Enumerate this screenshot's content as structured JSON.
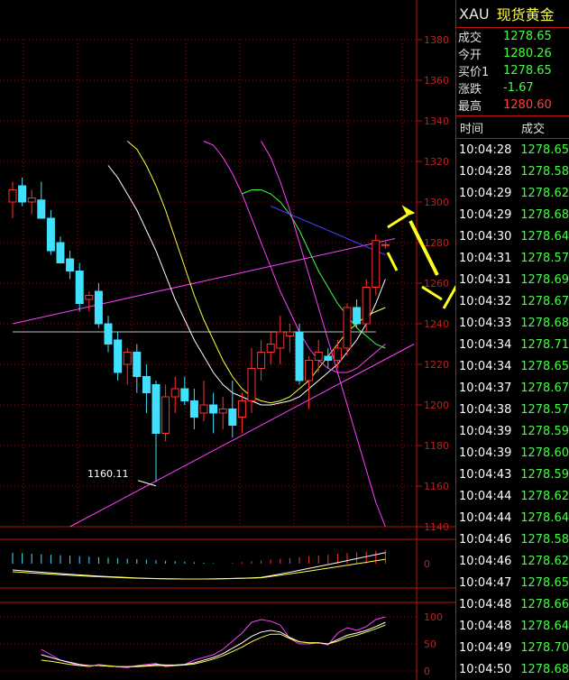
{
  "header": {
    "symbol": "XAU",
    "name": "现货黄金"
  },
  "quotes": [
    {
      "label": "成交",
      "value": "1278.65",
      "color": "green"
    },
    {
      "label": "今开",
      "value": "1280.26",
      "color": "green"
    },
    {
      "label": "买价1",
      "value": "1278.65",
      "color": "green"
    },
    {
      "label": "涨跌",
      "value": "-1.67",
      "color": "green"
    },
    {
      "label": "最高",
      "value": "1280.60",
      "color": "red"
    }
  ],
  "ticks_header": {
    "time": "时间",
    "price": "成交"
  },
  "ticks": [
    {
      "time": "10:04:28",
      "price": "1278.65"
    },
    {
      "time": "10:04:28",
      "price": "1278.58"
    },
    {
      "time": "10:04:29",
      "price": "1278.62"
    },
    {
      "time": "10:04:29",
      "price": "1278.68"
    },
    {
      "time": "10:04:30",
      "price": "1278.64"
    },
    {
      "time": "10:04:31",
      "price": "1278.57"
    },
    {
      "time": "10:04:31",
      "price": "1278.69"
    },
    {
      "time": "10:04:32",
      "price": "1278.67"
    },
    {
      "time": "10:04:33",
      "price": "1278.68"
    },
    {
      "time": "10:04:34",
      "price": "1278.71"
    },
    {
      "time": "10:04:34",
      "price": "1278.65"
    },
    {
      "time": "10:04:37",
      "price": "1278.67"
    },
    {
      "time": "10:04:38",
      "price": "1278.57"
    },
    {
      "time": "10:04:39",
      "price": "1278.59"
    },
    {
      "time": "10:04:39",
      "price": "1278.60"
    },
    {
      "time": "10:04:43",
      "price": "1278.59"
    },
    {
      "time": "10:04:44",
      "price": "1278.62"
    },
    {
      "time": "10:04:44",
      "price": "1278.64"
    },
    {
      "time": "10:04:46",
      "price": "1278.58"
    },
    {
      "time": "10:04:46",
      "price": "1278.62"
    },
    {
      "time": "10:04:47",
      "price": "1278.65"
    },
    {
      "time": "10:04:48",
      "price": "1278.66"
    },
    {
      "time": "10:04:48",
      "price": "1278.64"
    },
    {
      "time": "10:04:49",
      "price": "1278.70"
    },
    {
      "time": "10:04:50",
      "price": "1278.68"
    }
  ],
  "chart_data": {
    "type": "candlestick",
    "price_axis": {
      "labels": [
        "1380",
        "1360",
        "1340",
        "1320",
        "1300",
        "1280",
        "1260",
        "1240",
        "1220",
        "1200",
        "1180",
        "1160",
        "1140"
      ],
      "ylim": [
        1140,
        1380
      ]
    },
    "low_annotation": {
      "text": "1160.11",
      "value": 1160.11
    },
    "macd_axis": {
      "labels": [
        "0"
      ]
    },
    "osc_axis": {
      "labels": [
        "100",
        "50",
        "0"
      ],
      "ylim": [
        0,
        100
      ]
    },
    "candles": [
      {
        "o": 1300,
        "h": 1310,
        "l": 1292,
        "c": 1306
      },
      {
        "o": 1308,
        "h": 1312,
        "l": 1298,
        "c": 1300
      },
      {
        "o": 1300,
        "h": 1306,
        "l": 1294,
        "c": 1302
      },
      {
        "o": 1301,
        "h": 1310,
        "l": 1294,
        "c": 1292
      },
      {
        "o": 1292,
        "h": 1296,
        "l": 1274,
        "c": 1276
      },
      {
        "o": 1280,
        "h": 1283,
        "l": 1270,
        "c": 1270
      },
      {
        "o": 1272,
        "h": 1276,
        "l": 1262,
        "c": 1266
      },
      {
        "o": 1266,
        "h": 1270,
        "l": 1246,
        "c": 1250
      },
      {
        "o": 1252,
        "h": 1256,
        "l": 1246,
        "c": 1254
      },
      {
        "o": 1256,
        "h": 1260,
        "l": 1238,
        "c": 1240
      },
      {
        "o": 1240,
        "h": 1244,
        "l": 1226,
        "c": 1230
      },
      {
        "o": 1232,
        "h": 1236,
        "l": 1212,
        "c": 1216
      },
      {
        "o": 1220,
        "h": 1228,
        "l": 1210,
        "c": 1226
      },
      {
        "o": 1226,
        "h": 1230,
        "l": 1206,
        "c": 1214
      },
      {
        "o": 1214,
        "h": 1220,
        "l": 1196,
        "c": 1206
      },
      {
        "o": 1210,
        "h": 1212,
        "l": 1162,
        "c": 1186
      },
      {
        "o": 1186,
        "h": 1210,
        "l": 1182,
        "c": 1204
      },
      {
        "o": 1204,
        "h": 1214,
        "l": 1196,
        "c": 1208
      },
      {
        "o": 1208,
        "h": 1214,
        "l": 1200,
        "c": 1202
      },
      {
        "o": 1202,
        "h": 1208,
        "l": 1188,
        "c": 1194
      },
      {
        "o": 1196,
        "h": 1212,
        "l": 1192,
        "c": 1200
      },
      {
        "o": 1200,
        "h": 1206,
        "l": 1186,
        "c": 1196
      },
      {
        "o": 1196,
        "h": 1204,
        "l": 1188,
        "c": 1198
      },
      {
        "o": 1198,
        "h": 1212,
        "l": 1184,
        "c": 1190
      },
      {
        "o": 1194,
        "h": 1206,
        "l": 1186,
        "c": 1202
      },
      {
        "o": 1202,
        "h": 1228,
        "l": 1196,
        "c": 1218
      },
      {
        "o": 1218,
        "h": 1232,
        "l": 1212,
        "c": 1226
      },
      {
        "o": 1226,
        "h": 1236,
        "l": 1220,
        "c": 1230
      },
      {
        "o": 1228,
        "h": 1244,
        "l": 1220,
        "c": 1236
      },
      {
        "o": 1234,
        "h": 1240,
        "l": 1226,
        "c": 1236
      },
      {
        "o": 1236,
        "h": 1240,
        "l": 1210,
        "c": 1212
      },
      {
        "o": 1212,
        "h": 1224,
        "l": 1198,
        "c": 1222
      },
      {
        "o": 1222,
        "h": 1232,
        "l": 1216,
        "c": 1226
      },
      {
        "o": 1224,
        "h": 1228,
        "l": 1218,
        "c": 1222
      },
      {
        "o": 1222,
        "h": 1232,
        "l": 1218,
        "c": 1228
      },
      {
        "o": 1228,
        "h": 1250,
        "l": 1224,
        "c": 1248
      },
      {
        "o": 1248,
        "h": 1252,
        "l": 1238,
        "c": 1240
      },
      {
        "o": 1240,
        "h": 1262,
        "l": 1236,
        "c": 1258
      },
      {
        "o": 1258,
        "h": 1284,
        "l": 1254,
        "c": 1281
      },
      {
        "o": 1279,
        "h": 1281,
        "l": 1277,
        "c": 1279
      }
    ],
    "moving_averages": [
      {
        "color": "#ffffff",
        "values": [
          1318,
          1312,
          1304,
          1296,
          1286,
          1276,
          1264,
          1252,
          1242,
          1232,
          1224,
          1216,
          1210,
          1206,
          1204,
          1202,
          1200,
          1200,
          1201,
          1202,
          1204,
          1208,
          1212,
          1216,
          1220,
          1226,
          1232,
          1240,
          1250,
          1262
        ]
      },
      {
        "color": "#ffff40",
        "values": [
          1330,
          1326,
          1318,
          1308,
          1296,
          1282,
          1268,
          1254,
          1242,
          1232,
          1222,
          1214,
          1208,
          1204,
          1202,
          1201,
          1202,
          1204,
          1208,
          1212,
          1218,
          1224,
          1230,
          1236,
          1240,
          1244,
          1246,
          1248
        ]
      },
      {
        "color": "#ff40ff",
        "values": [
          1330,
          1328,
          1322,
          1314,
          1304,
          1292,
          1280,
          1268,
          1256,
          1246,
          1236,
          1228,
          1222,
          1218,
          1216,
          1216,
          1218,
          1222,
          1226,
          1230
        ]
      },
      {
        "color": "#40ff40",
        "values": [
          1304,
          1306,
          1306,
          1304,
          1300,
          1294,
          1286,
          1276,
          1266,
          1258,
          1250,
          1244,
          1238,
          1234,
          1230,
          1228
        ]
      },
      {
        "color": "#4040ff",
        "values": [
          1298,
          1296,
          1294,
          1292,
          1290,
          1288,
          1286,
          1284,
          1282,
          1280,
          1278,
          1276,
          1274
        ]
      },
      {
        "color": "#ff40ff",
        "values": [
          1330,
          1322,
          1310,
          1296,
          1280,
          1264,
          1248,
          1232,
          1216,
          1200,
          1184,
          1168,
          1152,
          1140
        ]
      }
    ],
    "trendlines": [
      {
        "color": "#ff40ff",
        "from": [
          0,
          1240
        ],
        "to": [
          40,
          1282
        ]
      },
      {
        "color": "#ff40ff",
        "from": [
          6,
          1140
        ],
        "to": [
          42,
          1230
        ]
      },
      {
        "color": "#c0c0c0",
        "from": [
          0,
          1236
        ],
        "to": [
          38,
          1236
        ]
      }
    ]
  }
}
